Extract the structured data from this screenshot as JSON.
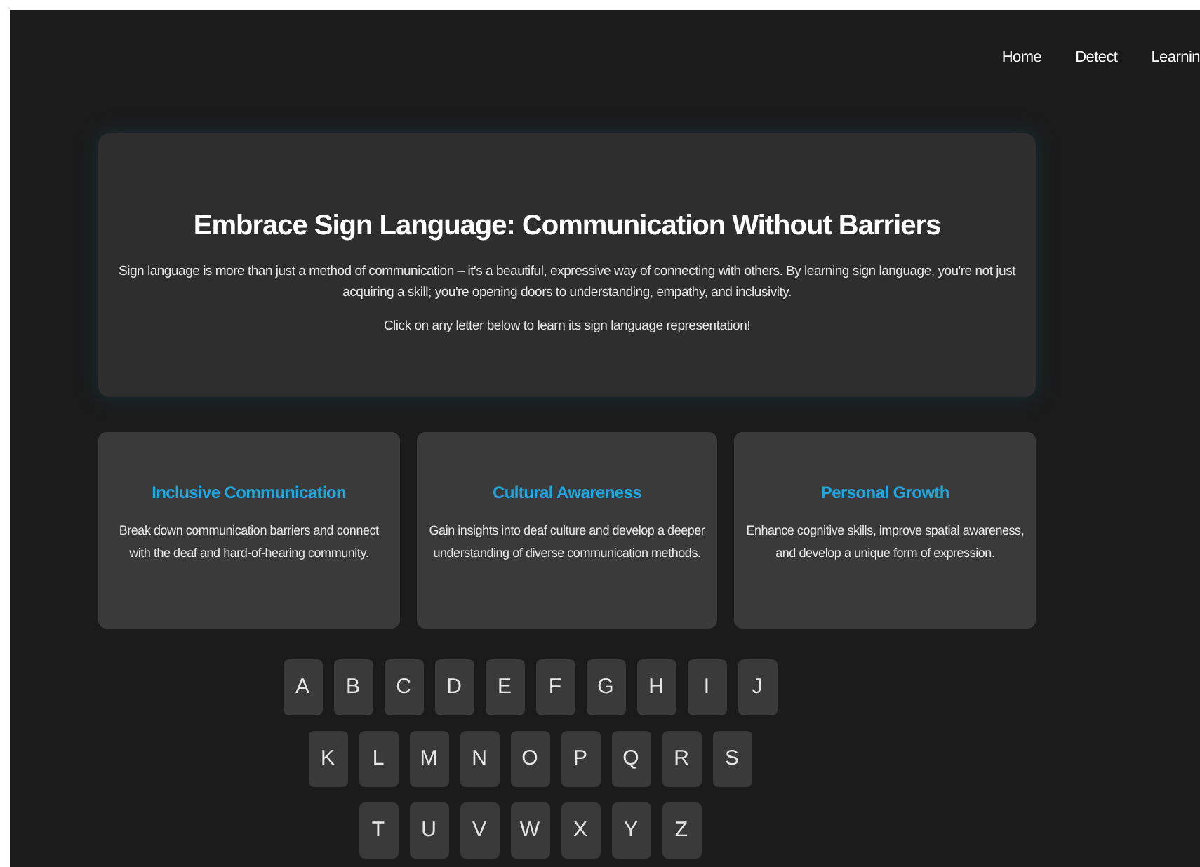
{
  "nav": [
    "Home",
    "Detect",
    "Learnin"
  ],
  "hero": {
    "title": "Embrace Sign Language: Communication Without Barriers",
    "body": "Sign language is more than just a method of communication – it's a beautiful, expressive way of connecting with others. By learning sign language, you're not just acquiring a skill; you're opening doors to understanding, empathy, and inclusivity.",
    "hint": "Click on any letter below to learn its sign language representation!"
  },
  "cards": [
    {
      "title": "Inclusive Communication",
      "text": "Break down communication barriers and connect with the deaf and hard-of-hearing community."
    },
    {
      "title": "Cultural Awareness",
      "text": "Gain insights into deaf culture and develop a deeper understanding of diverse communication methods."
    },
    {
      "title": "Personal Growth",
      "text": "Enhance cognitive skills, improve spatial awareness, and develop a unique form of expression."
    }
  ],
  "letter_rows": [
    [
      "A",
      "B",
      "C",
      "D",
      "E",
      "F",
      "G",
      "H",
      "I",
      "J"
    ],
    [
      "K",
      "L",
      "M",
      "N",
      "O",
      "P",
      "Q",
      "R",
      "S"
    ],
    [
      "T",
      "U",
      "V",
      "W",
      "X",
      "Y",
      "Z"
    ]
  ]
}
